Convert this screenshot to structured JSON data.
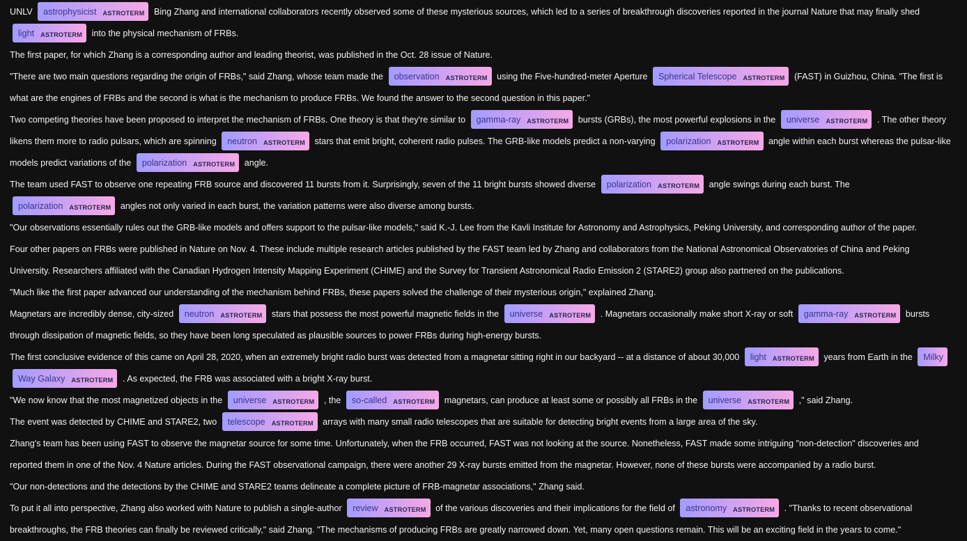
{
  "entity_label": "ASTROTERM",
  "colors": {
    "background": "#111112",
    "text": "#f2f2f2",
    "highlight_start": "#a39bff",
    "highlight_end": "#f6a8e6"
  },
  "paragraphs": [
    [
      {
        "t": "UNLV "
      },
      {
        "e": "astrophysicist"
      },
      {
        "t": " Bing Zhang and international collaborators recently observed some of these mysterious sources, which led to a series of breakthrough discoveries reported in the journal Nature that may finally shed "
      },
      {
        "e": "light"
      },
      {
        "t": " into the physical mechanism of FRBs."
      }
    ],
    [
      {
        "t": "The first paper, for which Zhang is a corresponding author and leading theorist, was published in the Oct. 28 issue of Nature."
      }
    ],
    [
      {
        "t": "\"There are two main questions regarding the origin of FRBs,\" said Zhang, whose team made the "
      },
      {
        "e": "observation"
      },
      {
        "t": " using the Five-hundred-meter Aperture "
      },
      {
        "e": "Spherical Telescope"
      },
      {
        "t": " (FAST) in Guizhou, China. \"The first is what are the engines of FRBs and the second is what is the mechanism to produce FRBs. We found the answer to the second question in this paper.\""
      }
    ],
    [
      {
        "t": "Two competing theories have been proposed to interpret the mechanism of FRBs. One theory is that they're similar to "
      },
      {
        "e": "gamma-ray"
      },
      {
        "t": " bursts (GRBs), the most powerful explosions in the "
      },
      {
        "e": "universe"
      },
      {
        "t": " . The other theory likens them more to radio pulsars, which are spinning "
      },
      {
        "e": "neutron"
      },
      {
        "t": " stars that emit bright, coherent radio pulses. The GRB-like models predict a non-varying "
      },
      {
        "e": "polarization"
      },
      {
        "t": " angle within each burst whereas the pulsar-like models predict variations of the "
      },
      {
        "e": "polarization"
      },
      {
        "t": " angle."
      }
    ],
    [
      {
        "t": "The team used FAST to observe one repeating FRB source and discovered 11 bursts from it. Surprisingly, seven of the 11 bright bursts showed diverse "
      },
      {
        "e": "polarization"
      },
      {
        "t": " angle swings during each burst. The "
      },
      {
        "e": "polarization"
      },
      {
        "t": " angles not only varied in each burst, the variation patterns were also diverse among bursts."
      }
    ],
    [
      {
        "t": "\"Our observations essentially rules out the GRB-like models and offers support to the pulsar-like models,\" said K.-J. Lee from the Kavli Institute for Astronomy and Astrophysics, Peking University, and corresponding author of the paper."
      }
    ],
    [
      {
        "t": "Four other papers on FRBs were published in Nature on Nov. 4. These include multiple research articles published by the FAST team led by Zhang and collaborators from the National Astronomical Observatories of China and Peking University. Researchers affiliated with the Canadian Hydrogen Intensity Mapping Experiment (CHIME) and the Survey for Transient Astronomical Radio Emission 2 (STARE2) group also partnered on the publications."
      }
    ],
    [
      {
        "t": "\"Much like the first paper advanced our understanding of the mechanism behind FRBs, these papers solved the challenge of their mysterious origin,\" explained Zhang."
      }
    ],
    [
      {
        "t": "Magnetars are incredibly dense, city-sized "
      },
      {
        "e": "neutron"
      },
      {
        "t": " stars that possess the most powerful magnetic fields in the "
      },
      {
        "e": "universe"
      },
      {
        "t": " . Magnetars occasionally make short X-ray or soft "
      },
      {
        "e": "gamma-ray"
      },
      {
        "t": " bursts through dissipation of magnetic fields, so they have been long speculated as plausible sources to power FRBs during high-energy bursts."
      }
    ],
    [
      {
        "t": "The first conclusive evidence of this came on April 28, 2020, when an extremely bright radio burst was detected from a magnetar sitting right in our backyard -- at a distance of about 30,000 "
      },
      {
        "e": "light"
      },
      {
        "t": " years from Earth in the "
      },
      {
        "e": "Milky Way Galaxy"
      },
      {
        "t": " . As expected, the FRB was associated with a bright X-ray burst."
      }
    ],
    [
      {
        "t": "\"We now know that the most magnetized objects in the "
      },
      {
        "e": "universe"
      },
      {
        "t": " , the "
      },
      {
        "e": "so-called"
      },
      {
        "t": " magnetars, can produce at least some or possibly all FRBs in the "
      },
      {
        "e": "universe"
      },
      {
        "t": " ,\" said Zhang."
      }
    ],
    [
      {
        "t": "The event was detected by CHIME and STARE2, two "
      },
      {
        "e": "telescope"
      },
      {
        "t": " arrays with many small radio telescopes that are suitable for detecting bright events from a large area of the sky."
      }
    ],
    [
      {
        "t": "Zhang's team has been using FAST to observe the magnetar source for some time. Unfortunately, when the FRB occurred, FAST was not looking at the source. Nonetheless, FAST made some intriguing \"non-detection\" discoveries and reported them in one of the Nov. 4 Nature articles. During the FAST observational campaign, there were another 29 X-ray bursts emitted from the magnetar. However, none of these bursts were accompanied by a radio burst."
      }
    ],
    [
      {
        "t": "\"Our non-detections and the detections by the CHIME and STARE2 teams delineate a complete picture of FRB-magnetar associations,\" Zhang said."
      }
    ],
    [
      {
        "t": "To put it all into perspective, Zhang also worked with Nature to publish a single-author "
      },
      {
        "e": "review"
      },
      {
        "t": " of the various discoveries and their implications for the field of "
      },
      {
        "e": "astronomy"
      },
      {
        "t": " . \"Thanks to recent observational breakthroughs, the FRB theories can finally be reviewed critically,\" said Zhang. \"The mechanisms of producing FRBs are greatly narrowed down. Yet, many open questions remain. This will be an exciting field in the years to come.\""
      }
    ]
  ]
}
